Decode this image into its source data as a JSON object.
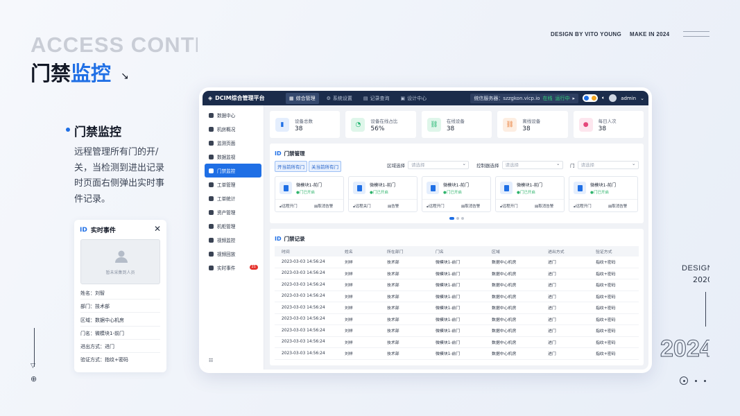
{
  "hero": {
    "en": "ACCESS CONTRO",
    "cn_a": "门禁",
    "cn_b": "监控"
  },
  "top": {
    "design_by": "DESIGN BY VITO YOUNG",
    "make_in": "MAKE IN 2024"
  },
  "feature": {
    "title": "门禁监控",
    "desc": "远程管理所有门的开/关，当检测到进出记录时页面右侧弹出实时事件记录。"
  },
  "realtime": {
    "title": "实时事件",
    "photo_caption": "暂未采集到人员",
    "rows": [
      "姓名：刘智",
      "部门：技术部",
      "区域：数据中心机房",
      "门名：微模块1-前门",
      "进出方式：进门",
      "验证方式：指纹+密码"
    ]
  },
  "right": {
    "design": "DESIGN",
    "year_a": "2020",
    "year_big": "2024"
  },
  "app": {
    "brand": "DCIM综合管理平台",
    "nav": [
      {
        "label": "综合管理",
        "active": true
      },
      {
        "label": "系统设置",
        "active": false
      },
      {
        "label": "记录查询",
        "active": false
      },
      {
        "label": "设计中心",
        "active": false
      }
    ],
    "server": {
      "label": "统信服务器：szzgkon.vicp.io",
      "online": "在线",
      "status": "运行中"
    },
    "user": "admin",
    "sidebar": [
      {
        "label": "数据中心",
        "active": false
      },
      {
        "label": "机房概况",
        "active": false
      },
      {
        "label": "监测页面",
        "active": false
      },
      {
        "label": "数据监视",
        "active": false
      },
      {
        "label": "门禁监控",
        "active": true
      },
      {
        "label": "工单管理",
        "active": false
      },
      {
        "label": "工单统计",
        "active": false
      },
      {
        "label": "资产管理",
        "active": false
      },
      {
        "label": "机柜管理",
        "active": false
      },
      {
        "label": "视频监控",
        "active": false
      },
      {
        "label": "视频回放",
        "active": false
      },
      {
        "label": "实时事件",
        "active": false,
        "badge": "21"
      }
    ],
    "stats": [
      {
        "label": "设备总数",
        "value": "38",
        "color": "#1f6fe5",
        "bg": "#e4eefd",
        "icon": "▮"
      },
      {
        "label": "设备在线占比",
        "value": "56%",
        "color": "#17b26a",
        "bg": "#dff6ea",
        "icon": "◔"
      },
      {
        "label": "在线设备",
        "value": "38",
        "color": "#17b26a",
        "bg": "#dff6ea",
        "icon": "⛓"
      },
      {
        "label": "离线设备",
        "value": "38",
        "color": "#e8762c",
        "bg": "#fdeee2",
        "icon": "⛓"
      },
      {
        "label": "每日人次",
        "value": "38",
        "color": "#e5477a",
        "bg": "#fde6ee",
        "icon": "●"
      }
    ],
    "access": {
      "title": "门禁管理",
      "open_all": "开当前所有门",
      "close_all": "关当前所有门",
      "filters": [
        {
          "label": "区域选择",
          "placeholder": "请选择"
        },
        {
          "label": "控制器选择",
          "placeholder": "请选择"
        },
        {
          "label": "门",
          "placeholder": "请选择"
        }
      ],
      "doors": [
        {
          "name": "微模块1-前门",
          "status": "门已开启",
          "b1": "远程开门",
          "b2": "取消告警"
        },
        {
          "name": "微模块1-前门",
          "status": "门已开启",
          "b1": "远程关门",
          "b2": "告警"
        },
        {
          "name": "微模块1-前门",
          "status": "门已开启",
          "b1": "远程开门",
          "b2": "取消告警"
        },
        {
          "name": "微模块1-前门",
          "status": "门已开启",
          "b1": "远程开门",
          "b2": "取消告警"
        },
        {
          "name": "微模块1-前门",
          "status": "门已开启",
          "b1": "远程开门",
          "b2": "取消告警"
        }
      ]
    },
    "records": {
      "title": "门禁记录",
      "headers": [
        "时间",
        "姓名",
        "所在部门",
        "门名",
        "区域",
        "进出方式",
        "验证方式"
      ],
      "rows": [
        [
          "2023-03-03 14:56:24",
          "刘祥",
          "技术部",
          "微模块1-前门",
          "数据中心机房",
          "进门",
          "指纹+密码"
        ],
        [
          "2023-03-03 14:56:24",
          "刘祥",
          "技术部",
          "微模块1-前门",
          "数据中心机房",
          "进门",
          "指纹+密码"
        ],
        [
          "2023-03-03 14:56:24",
          "刘祥",
          "技术部",
          "微模块1-前门",
          "数据中心机房",
          "进门",
          "指纹+密码"
        ],
        [
          "2023-03-03 14:56:24",
          "刘祥",
          "技术部",
          "微模块1-前门",
          "数据中心机房",
          "进门",
          "指纹+密码"
        ],
        [
          "2023-03-03 14:56:24",
          "刘祥",
          "技术部",
          "微模块1-前门",
          "数据中心机房",
          "进门",
          "指纹+密码"
        ],
        [
          "2023-03-03 14:56:24",
          "刘祥",
          "技术部",
          "微模块1-前门",
          "数据中心机房",
          "进门",
          "指纹+密码"
        ],
        [
          "2023-03-03 14:56:24",
          "刘祥",
          "技术部",
          "微模块1-前门",
          "数据中心机房",
          "进门",
          "指纹+密码"
        ],
        [
          "2023-03-03 14:56:24",
          "刘祥",
          "技术部",
          "微模块1-前门",
          "数据中心机房",
          "进门",
          "指纹+密码"
        ],
        [
          "2023-03-03 14:56:24",
          "刘祥",
          "技术部",
          "微模块1-前门",
          "数据中心机房",
          "进门",
          "指纹+密码"
        ]
      ]
    }
  }
}
